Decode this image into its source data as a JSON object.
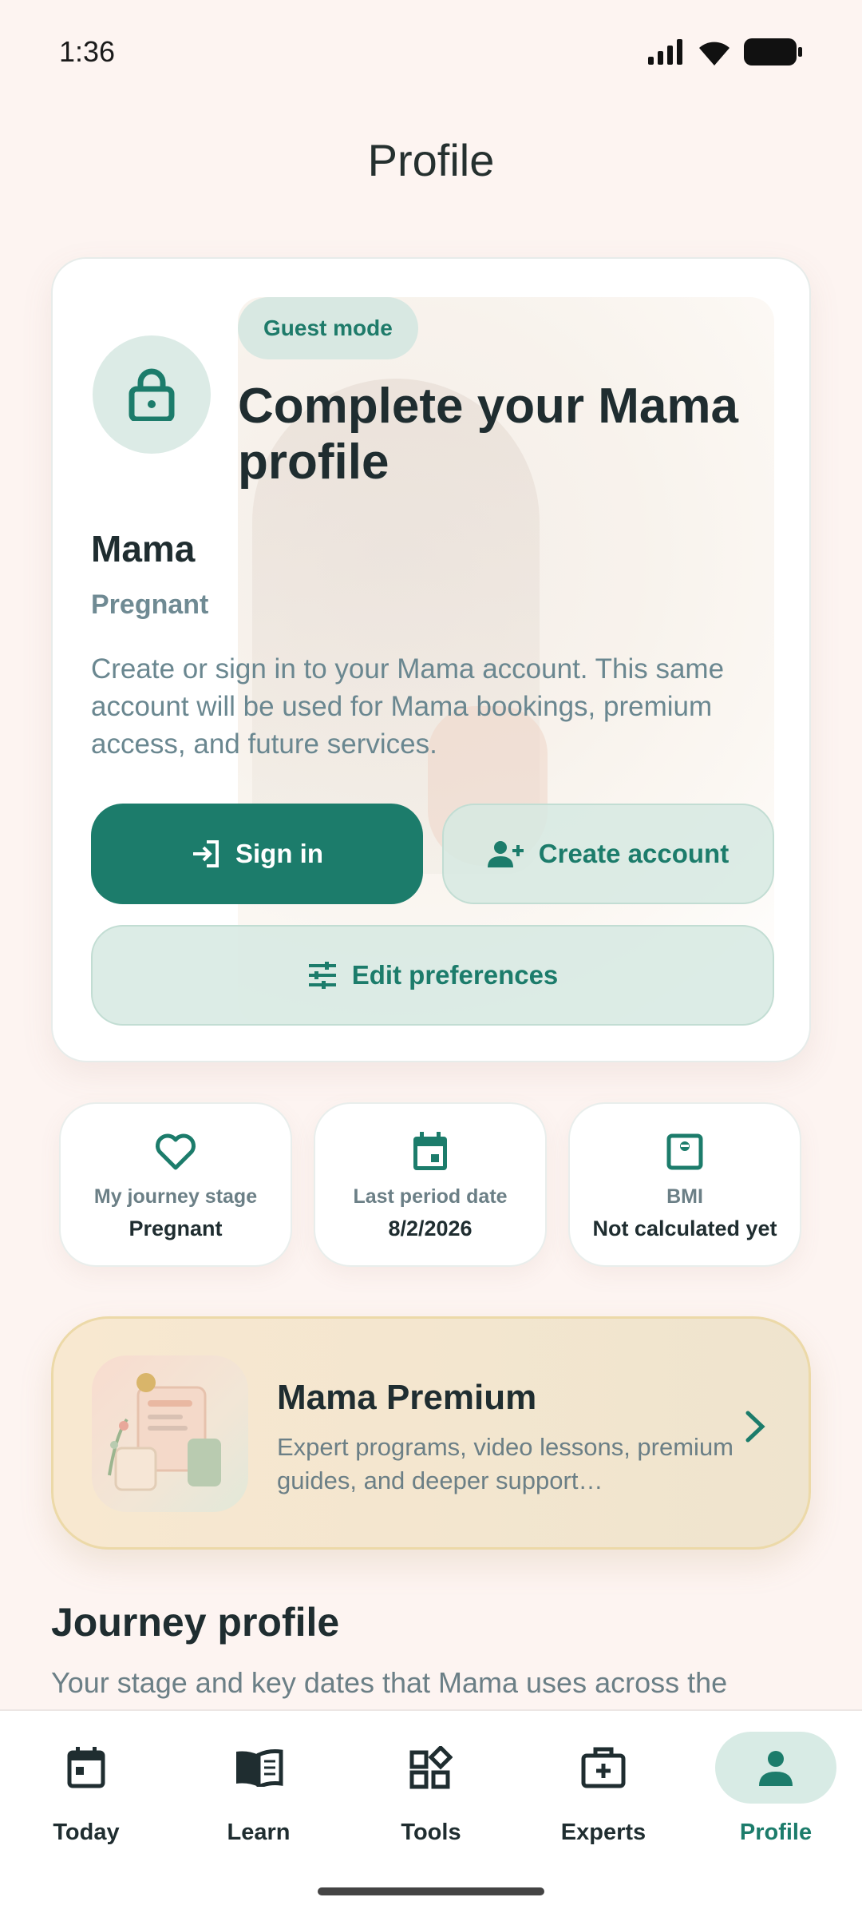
{
  "status_bar": {
    "time": "1:36"
  },
  "page": {
    "title": "Profile"
  },
  "profile_card": {
    "badge": "Guest mode",
    "headline": "Complete your Mama profile",
    "name": "Mama",
    "stage": "Pregnant",
    "description": "Create or sign in to your Mama account. This same account will be used for Mama bookings, premium access, and future services.",
    "sign_in_label": "Sign in",
    "create_account_label": "Create account",
    "edit_preferences_label": "Edit preferences"
  },
  "stats": [
    {
      "label": "My journey stage",
      "value": "Pregnant",
      "icon": "heart-icon"
    },
    {
      "label": "Last period date",
      "value": "8/2/2026",
      "icon": "calendar-icon"
    },
    {
      "label": "BMI",
      "value": "Not calculated yet",
      "icon": "scale-icon"
    }
  ],
  "premium": {
    "title": "Mama Premium",
    "subtitle": "Expert programs, video lessons, premium guides, and deeper support…"
  },
  "journey": {
    "title": "Journey profile",
    "subtitle": "Your stage and key dates that Mama uses across the"
  },
  "nav": [
    {
      "label": "Today",
      "icon": "calendar-icon"
    },
    {
      "label": "Learn",
      "icon": "book-icon"
    },
    {
      "label": "Tools",
      "icon": "widgets-icon"
    },
    {
      "label": "Experts",
      "icon": "medical-kit-icon"
    },
    {
      "label": "Profile",
      "icon": "person-icon",
      "active": true
    }
  ],
  "colors": {
    "accent": "#1c7c6b",
    "accent_soft": "#d8ebe5",
    "background": "#fdf4f1",
    "premium": "#f4e6cf"
  }
}
